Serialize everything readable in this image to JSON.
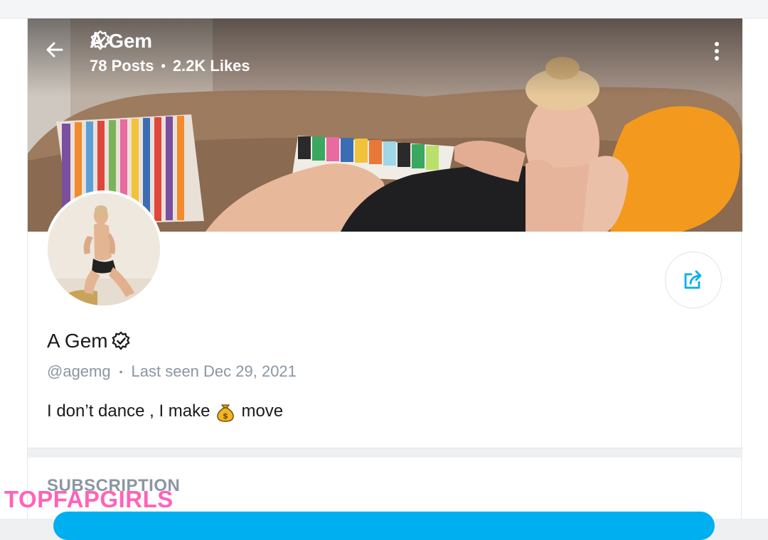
{
  "header": {
    "name": "A Gem",
    "posts": "78 Posts",
    "likes": "2.2K Likes",
    "dot": "•"
  },
  "profile": {
    "name": "A Gem",
    "handle": "@agemg",
    "dot": "•",
    "last_seen": "Last seen Dec 29, 2021",
    "bio_before": "I don’t dance , I make",
    "bio_after": "move"
  },
  "subscription": {
    "title": "SUBSCRIPTION"
  },
  "watermark": "TOPFAPGIRLS",
  "colors": {
    "accent": "#00aff0",
    "muted_text": "#8a96a3",
    "primary_text": "#1a1a1a",
    "watermark": "#ff63b8"
  },
  "icons": {
    "back": "arrow-left-icon",
    "more": "more-vertical-icon",
    "verified": "verified-badge-icon",
    "share": "share-icon",
    "moneybag": "money-bag-emoji"
  }
}
